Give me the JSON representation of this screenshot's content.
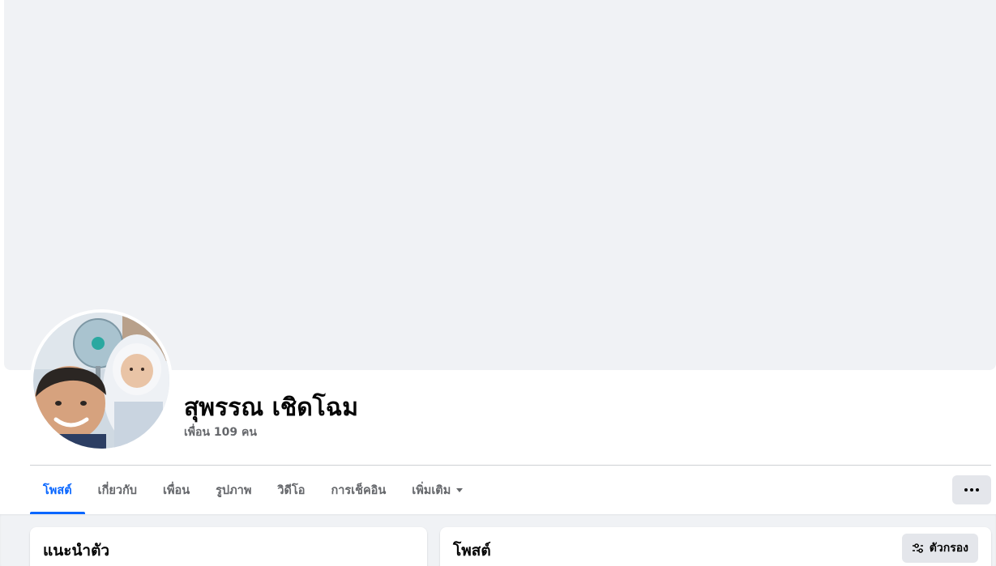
{
  "profile": {
    "name": "สุพรรณ เชิดโฉม",
    "friends": "เพื่อน 109 คน"
  },
  "tabs": [
    {
      "label": "โพสต์",
      "active": true
    },
    {
      "label": "เกี่ยวกับ",
      "active": false
    },
    {
      "label": "เพื่อน",
      "active": false
    },
    {
      "label": "รูปภาพ",
      "active": false
    },
    {
      "label": "วิดีโอ",
      "active": false
    },
    {
      "label": "การเช็คอิน",
      "active": false
    },
    {
      "label": "เพิ่มเติม",
      "active": false
    }
  ],
  "cards": {
    "intro_title": "แนะนำตัว",
    "posts_title": "โพสต์",
    "filter_label": "ตัวกรอง"
  },
  "colors": {
    "accent": "#0866ff",
    "cover": "#f0f2f5",
    "button_bg": "#e4e6eb",
    "secondary_text": "#65676b"
  },
  "icons": {
    "more": "more-dots-icon",
    "dropdown": "caret-down-icon",
    "filter": "filter-sliders-icon"
  }
}
